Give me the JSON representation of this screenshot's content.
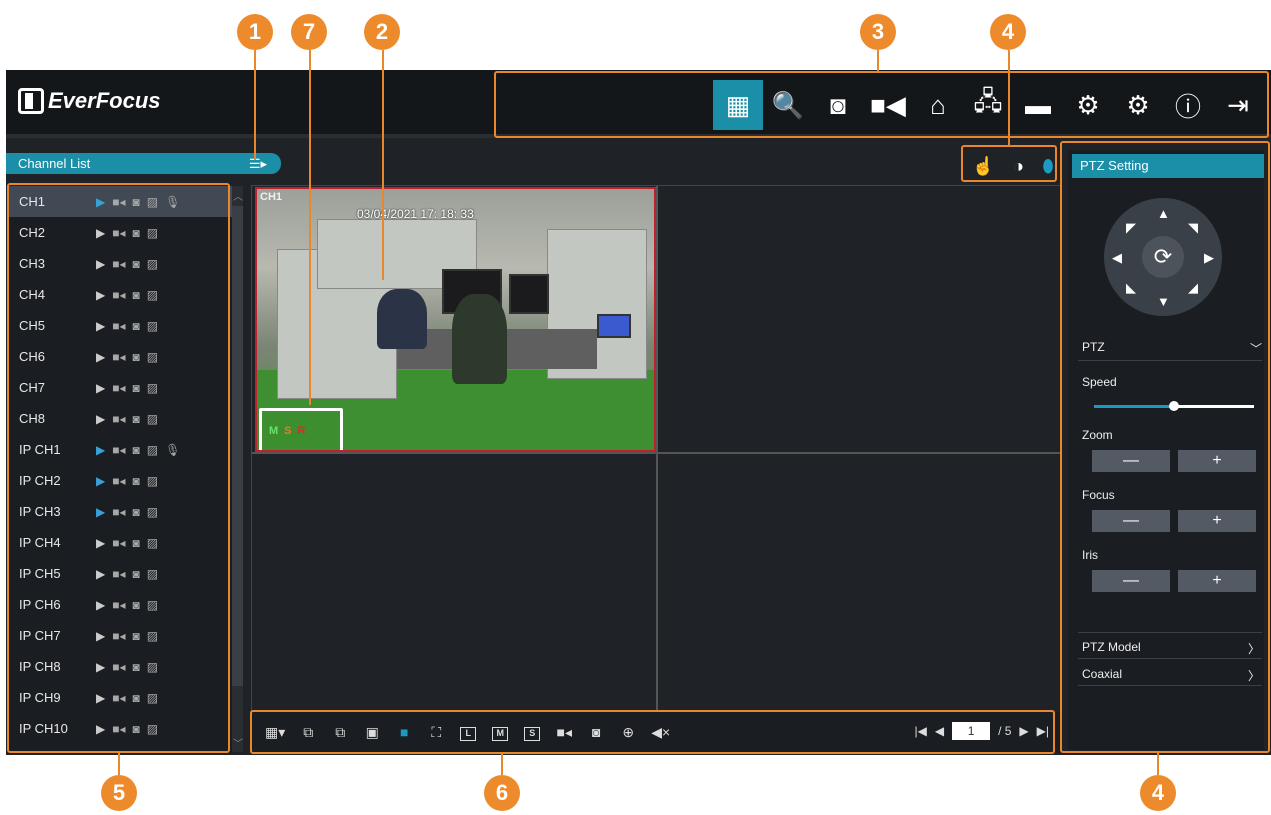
{
  "brand": {
    "name": "EverFocus"
  },
  "menu": {
    "items": [
      {
        "name": "live-view-icon",
        "glyph": "▦"
      },
      {
        "name": "playback-search-icon",
        "glyph": "🔍"
      },
      {
        "name": "snapshot-icon",
        "glyph": "◙"
      },
      {
        "name": "record-icon",
        "glyph": "■◀"
      },
      {
        "name": "alarm-icon",
        "glyph": "⌂"
      },
      {
        "name": "network-icon",
        "glyph": "🖧"
      },
      {
        "name": "storage-icon",
        "glyph": "▬"
      },
      {
        "name": "settings-icon",
        "glyph": "⚙"
      },
      {
        "name": "advanced-settings-icon",
        "glyph": "⚙"
      },
      {
        "name": "info-icon",
        "glyph": "ⓘ"
      },
      {
        "name": "logout-icon",
        "glyph": "⇥"
      }
    ]
  },
  "channel_list": {
    "title": "Channel List",
    "channels": [
      {
        "label": "CH1",
        "live": true,
        "audio": true,
        "selected": true
      },
      {
        "label": "CH2",
        "live": false,
        "audio": false
      },
      {
        "label": "CH3",
        "live": false,
        "audio": false
      },
      {
        "label": "CH4",
        "live": false,
        "audio": false
      },
      {
        "label": "CH5",
        "live": false,
        "audio": false
      },
      {
        "label": "CH6",
        "live": false,
        "audio": false
      },
      {
        "label": "CH7",
        "live": false,
        "audio": false
      },
      {
        "label": "CH8",
        "live": false,
        "audio": false
      },
      {
        "label": "IP CH1",
        "live": true,
        "audio": true
      },
      {
        "label": "IP CH2",
        "live": true,
        "audio": false
      },
      {
        "label": "IP CH3",
        "live": true,
        "audio": false
      },
      {
        "label": "IP CH4",
        "live": false,
        "audio": false
      },
      {
        "label": "IP CH5",
        "live": false,
        "audio": false
      },
      {
        "label": "IP CH6",
        "live": false,
        "audio": false
      },
      {
        "label": "IP CH7",
        "live": false,
        "audio": false
      },
      {
        "label": "IP CH8",
        "live": false,
        "audio": false
      },
      {
        "label": "IP CH9",
        "live": false,
        "audio": false
      },
      {
        "label": "IP CH10",
        "live": false,
        "audio": false
      }
    ]
  },
  "camera": {
    "label": "CH1",
    "timestamp": "03/04/2021  17: 18: 33",
    "status": [
      "M",
      "S",
      "R"
    ]
  },
  "toolbar": {
    "buttons": [
      {
        "name": "layout-select-button",
        "text": "▦▾"
      },
      {
        "name": "previous-group-button",
        "text": "⧉"
      },
      {
        "name": "next-group-button",
        "text": "⧉"
      },
      {
        "name": "single-screen-button",
        "text": "▣"
      },
      {
        "name": "full-display-button",
        "text": "■",
        "active": true
      },
      {
        "name": "fullscreen-button",
        "text": "⛶"
      },
      {
        "name": "bitrate-l-button",
        "text": "L",
        "boxed": true
      },
      {
        "name": "bitrate-m-button",
        "text": "M",
        "boxed": true
      },
      {
        "name": "bitrate-s-button",
        "text": "S",
        "boxed": true
      },
      {
        "name": "record-all-button",
        "text": "■◂"
      },
      {
        "name": "snapshot-button",
        "text": "◙"
      },
      {
        "name": "zoom-in-button",
        "text": "⊕"
      },
      {
        "name": "mute-button",
        "text": "◀×"
      }
    ],
    "pager": {
      "current": "1",
      "total": "/ 5"
    }
  },
  "ptz": {
    "title": "PTZ Setting",
    "dropdown_label": "PTZ",
    "speed_label": "Speed",
    "speed_level": 0.5,
    "zoom_label": "Zoom",
    "focus_label": "Focus",
    "iris_label": "Iris",
    "minus": "—",
    "plus": "+",
    "model_label": "PTZ Model",
    "coaxial_label": "Coaxial"
  },
  "callouts": [
    "1",
    "7",
    "2",
    "3",
    "4",
    "5",
    "6",
    "4"
  ],
  "colors": {
    "accent": "#1b8fa7",
    "callout": "#ed8a2b",
    "selected_border": "#c0202e"
  }
}
